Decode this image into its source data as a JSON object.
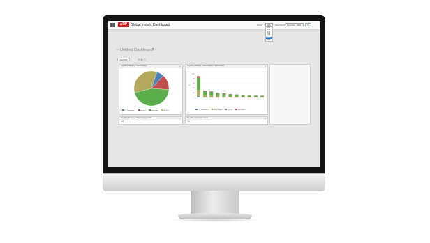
{
  "app": {
    "logo_text": "ADP",
    "title": "Global Insight Dashboard"
  },
  "header": {
    "period_label": "Period",
    "period_value": "2015",
    "period_options": [
      "2011",
      "2012",
      "2013",
      "2014",
      "2015",
      "2016"
    ],
    "period_selected_index": 4,
    "month_label": "Date Month",
    "month_value": "September - 2015 ▾",
    "go_label": "Go",
    "menu_icon": "hamburger-menu-icon"
  },
  "dashboard": {
    "title": "Untitled Dashboard",
    "star_icon": "star-icon",
    "bell_icon": "alert-icon"
  },
  "tabs": [
    {
      "label": "New Tab"
    }
  ],
  "panels": {
    "pie": {
      "title": "Payroll by Category / Total Company",
      "legend": [
        "OT Contributions",
        "Bonuses",
        "Deductions",
        "Net Pay"
      ]
    },
    "bar": {
      "title": "Payroll by Category / Total Company & Cost Centers",
      "legend": [
        "OT Contributions",
        "Gross Wages",
        "Net Pay",
        "Deductions"
      ],
      "ytitle": "Cost"
    },
    "bottom_left": {
      "title": "Payroll by Employee / Total Company Profit",
      "value": "100k"
    },
    "bottom_right": {
      "title": "Payroll by Cost Center Detail",
      "value": "1.4k"
    }
  },
  "colors": {
    "blue": "#4f81bd",
    "red": "#c0504d",
    "green": "#5aad4a",
    "olive": "#b2a85e",
    "brand": "#d71921"
  },
  "chart_data": [
    {
      "type": "pie",
      "title": "Payroll by Category / Total Company",
      "categories": [
        "OT Contributions",
        "Bonuses",
        "Deductions",
        "Net Pay"
      ],
      "values": [
        7,
        14,
        45,
        34
      ]
    },
    {
      "type": "bar",
      "title": "Payroll by Category / Total Company & Cost Centers",
      "ylabel": "Cost",
      "ylim": [
        0,
        1000
      ],
      "yticks": [
        0,
        200,
        400,
        600,
        800,
        1000
      ],
      "categories": [
        "C1",
        "C2",
        "C3",
        "C4",
        "C5",
        "C6",
        "C7",
        "C8",
        "C9",
        "C10",
        "C11"
      ],
      "series": [
        {
          "name": "OT Contributions",
          "values": [
            40,
            10,
            10,
            5,
            5,
            5,
            5,
            4,
            4,
            3,
            3
          ]
        },
        {
          "name": "Gross Wages",
          "values": [
            280,
            80,
            70,
            50,
            45,
            40,
            35,
            30,
            25,
            20,
            20
          ]
        },
        {
          "name": "Net Pay",
          "values": [
            510,
            180,
            160,
            130,
            110,
            95,
            80,
            65,
            55,
            50,
            45
          ]
        },
        {
          "name": "Deductions",
          "values": [
            70,
            20,
            20,
            15,
            15,
            10,
            10,
            10,
            8,
            7,
            7
          ]
        }
      ]
    }
  ]
}
